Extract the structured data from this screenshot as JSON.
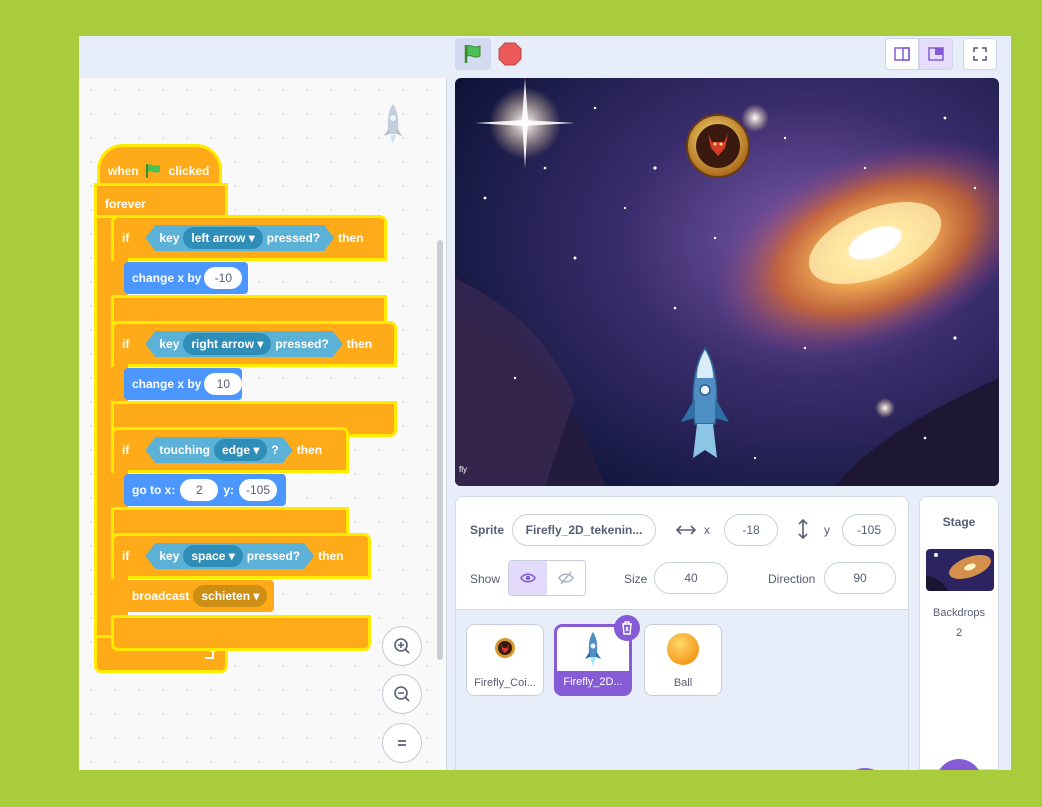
{
  "colors": {
    "background": "#a8cc3c",
    "events": "#ffab19",
    "sensing": "#5cb1d6",
    "motion": "#4c97ff",
    "accent": "#855cd6",
    "highlight": "#ffea00"
  },
  "blocks": {
    "hat": {
      "when": "when",
      "clicked": "clicked"
    },
    "forever": "forever",
    "if1": {
      "if": "if",
      "key": "key",
      "option": "left arrow",
      "pressed": "pressed?",
      "then": "then",
      "action": "change x by",
      "value": "-10"
    },
    "if2": {
      "if": "if",
      "key": "key",
      "option": "right arrow",
      "pressed": "pressed?",
      "then": "then",
      "action": "change x by",
      "value": "10"
    },
    "if3": {
      "if": "if",
      "touching": "touching",
      "option": "edge",
      "q": "?",
      "then": "then",
      "action": "go to x:",
      "x": "2",
      "ylabel": "y:",
      "y": "-105"
    },
    "if4": {
      "if": "if",
      "key": "key",
      "option": "space",
      "pressed": "pressed?",
      "then": "then",
      "action": "broadcast",
      "message": "schieten"
    }
  },
  "sprite_info": {
    "sprite_label": "Sprite",
    "sprite_name": "Firefly_2D_tekenin...",
    "x_label": "x",
    "x": "-18",
    "y_label": "y",
    "y": "-105",
    "show_label": "Show",
    "size_label": "Size",
    "size": "40",
    "direction_label": "Direction",
    "direction": "90"
  },
  "sprites": [
    {
      "name": "Firefly_Coi...",
      "icon": "coin-sprite-icon",
      "selected": false
    },
    {
      "name": "Firefly_2D...",
      "icon": "rocket-sprite-icon",
      "selected": true
    },
    {
      "name": "Ball",
      "icon": "ball-sprite-icon",
      "selected": false
    }
  ],
  "stage_pane": {
    "title": "Stage",
    "backdrops_label": "Backdrops",
    "backdrops_count": "2"
  },
  "stage": {
    "corner_text": "fly"
  }
}
